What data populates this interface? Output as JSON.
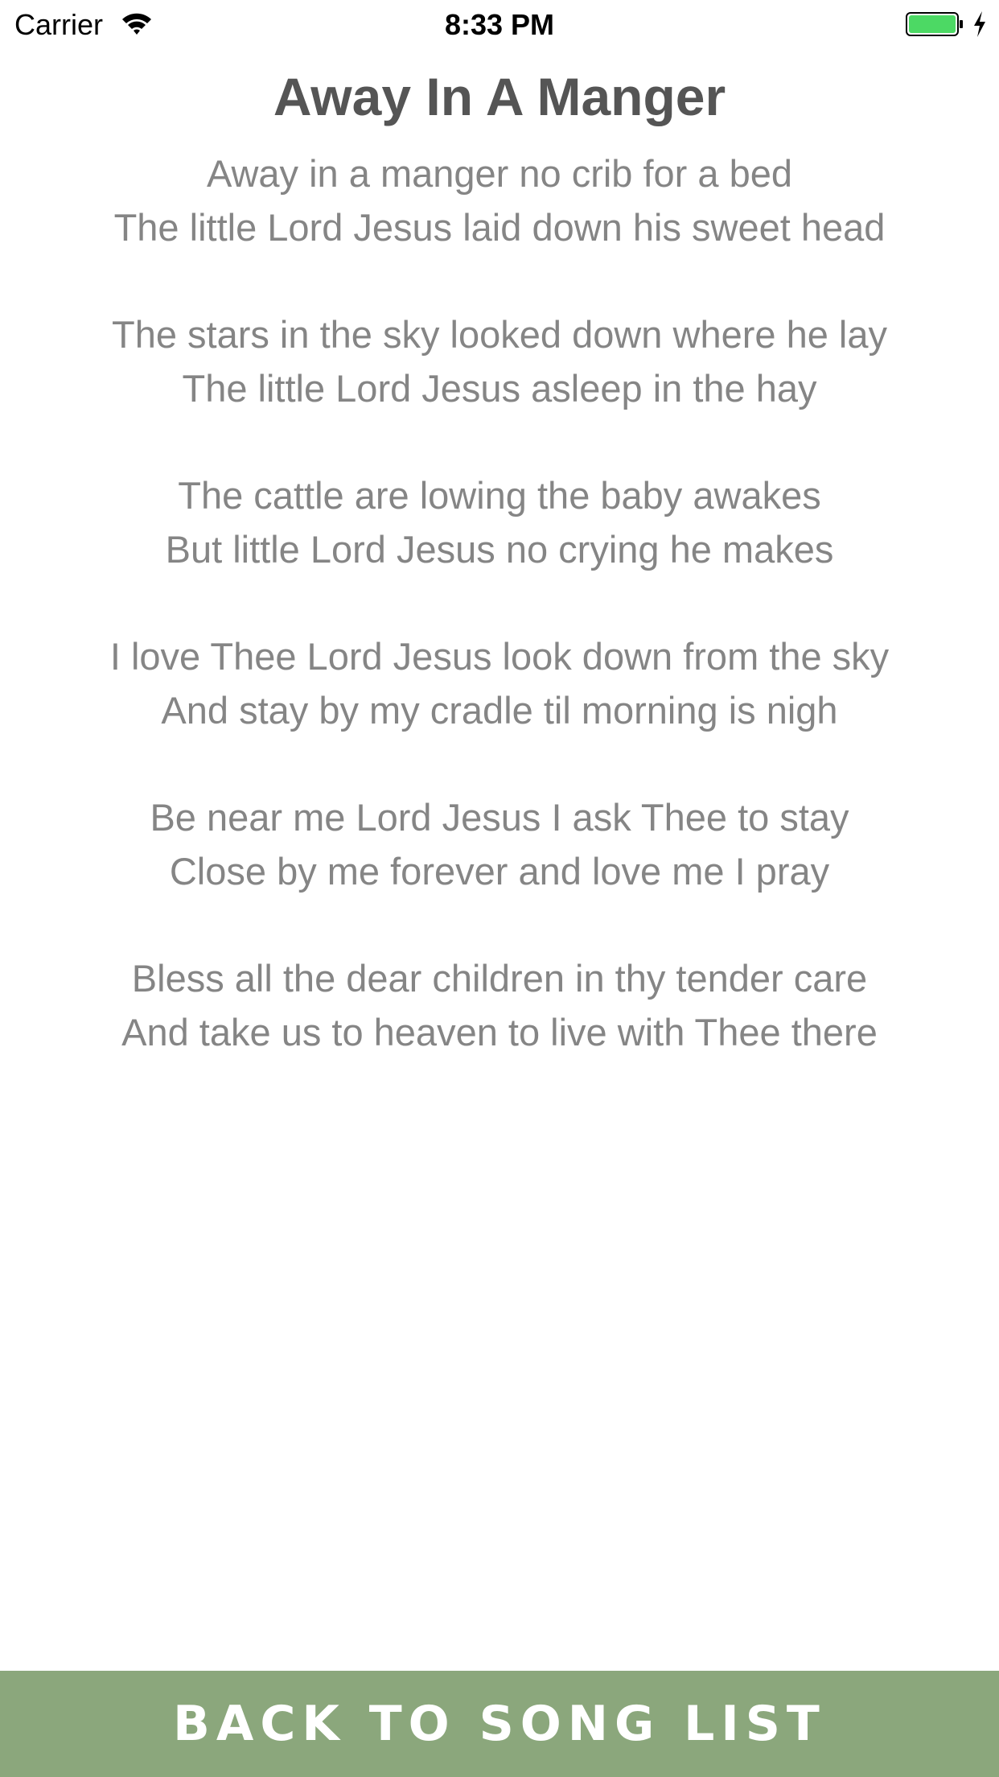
{
  "status_bar": {
    "carrier": "Carrier",
    "time": "8:33 PM",
    "battery_color": "#4cd964",
    "icons": [
      "wifi-icon",
      "battery-icon",
      "charging-bolt-icon"
    ]
  },
  "song": {
    "title": "Away In A Manger",
    "stanzas": [
      [
        "Away in a manger no crib for a bed",
        "The little Lord Jesus laid down his sweet head"
      ],
      [
        "The stars in the sky looked down where he lay",
        "The little Lord Jesus asleep in the hay"
      ],
      [
        "The cattle are lowing the baby awakes",
        "But little Lord Jesus no crying he makes"
      ],
      [
        "I love Thee Lord Jesus look down from the sky",
        "And stay by my cradle til morning is nigh"
      ],
      [
        "Be near me Lord Jesus I ask Thee to stay",
        "Close by me forever and love me I pray"
      ],
      [
        "Bless all the dear children in thy tender care",
        "And take us to heaven to live with Thee there"
      ]
    ]
  },
  "footer": {
    "back_label": "BACK TO SONG LIST",
    "background_color": "#8ba77c"
  }
}
